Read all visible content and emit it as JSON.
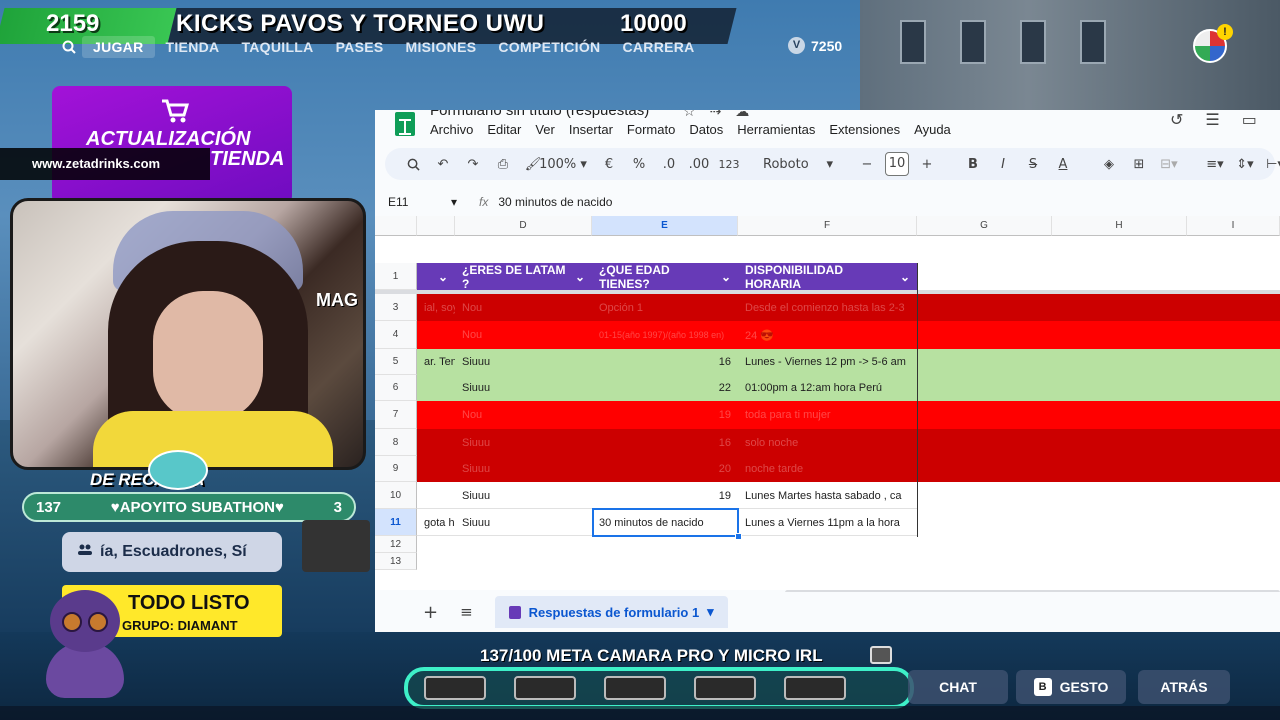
{
  "hud": {
    "score": "2159",
    "title": "KICKS PAVOS Y TORNEO UWU",
    "target": "10000",
    "nav": [
      "JUGAR",
      "TIENDA",
      "TAQUILLA",
      "PASES",
      "MISIONES",
      "COMPETICIÓN",
      "CARRERA"
    ],
    "vbucks": "7250",
    "alert": "!"
  },
  "overlay": {
    "promo_line1": "ACTUALIZACIÓN",
    "promo_line2": "TIENDA",
    "site": "www.zetadrinks.com",
    "cam_label": "DE RECARGA",
    "cam_mag": "MAG",
    "subathon_left": "137",
    "subathon_center": "♥APOYITO SUBATHON♥",
    "subathon_right": "3",
    "squad_text": "ía, Escuadrones, Sí",
    "card_line1": "TODO LISTO",
    "card_line2": "GRUPO: DIAMANT"
  },
  "sheets": {
    "doc_title": "Formulario sin título (respuestas)",
    "menus": [
      "Archivo",
      "Editar",
      "Ver",
      "Insertar",
      "Formato",
      "Datos",
      "Herramientas",
      "Extensiones",
      "Ayuda"
    ],
    "zoom": "100%",
    "currency": "€",
    "percent": "%",
    "dec_less": ".0",
    "dec_more": ".00",
    "format_123": "123",
    "font": "Roboto",
    "font_size": "10",
    "name_box": "E11",
    "formula": "30 minutos de nacido",
    "columns": [
      "D",
      "E",
      "F",
      "G",
      "H",
      "I"
    ],
    "headers": [
      "¿ERES DE LATAM ?",
      "¿QUE EDAD TIENES?",
      "DISPONIBILIDAD HORARIA"
    ],
    "rows": [
      {
        "n": "3",
        "c": "ial, soy",
        "d": "Nou",
        "e": "Opción 1",
        "f": "Desde el comienzo hasta las 2-3"
      },
      {
        "n": "4",
        "c": "",
        "d": "Nou",
        "e": "01-15(año 1997)/(año 1998 en)",
        "f": "24 😎"
      },
      {
        "n": "5",
        "c": "ar. Teng",
        "d": "Siuuu",
        "e": "16",
        "f": "Lunes - Viernes 12 pm -> 5-6 am"
      },
      {
        "n": "6",
        "c": "",
        "d": "Siuuu",
        "e": "22",
        "f": "01:00pm a 12:am hora Perú"
      },
      {
        "n": "7",
        "c": "",
        "d": "Nou",
        "e": "19",
        "f": "toda para ti mujer"
      },
      {
        "n": "8",
        "c": "",
        "d": "Siuuu",
        "e": "16",
        "f": "solo noche"
      },
      {
        "n": "9",
        "c": "",
        "d": "Siuuu",
        "e": "20",
        "f": "noche tarde"
      },
      {
        "n": "10",
        "c": "",
        "d": "Siuuu",
        "e": "19",
        "f": "Lunes Martes hasta sabado , ca"
      },
      {
        "n": "11",
        "c": "gota hat",
        "d": "Siuuu",
        "e": "30 minutos de nacido",
        "f": "Lunes a Viernes 11pm a la hora"
      },
      {
        "n": "12",
        "c": "",
        "d": "",
        "e": "",
        "f": ""
      },
      {
        "n": "13",
        "c": "",
        "d": "",
        "e": "",
        "f": ""
      }
    ],
    "row_one": "1",
    "sheet_tab": "Respuestas de formulario 1",
    "colors": {
      "header": "#673ab7",
      "red": "#ff0000",
      "dark_red": "#cc0000",
      "green": "#b7e1a1"
    }
  },
  "bottom": {
    "meta": "137/100 META CAMARA PRO Y MICRO IRL",
    "chat": "CHAT",
    "gesture_key": "B",
    "gesture": "GESTO",
    "back": "ATRÁS",
    "progress": 1.0
  }
}
